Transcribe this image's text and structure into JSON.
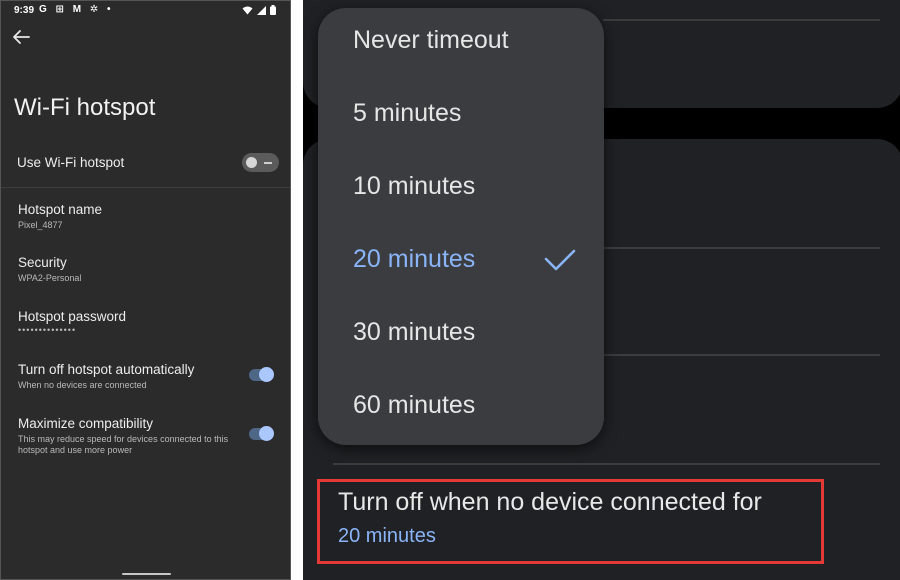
{
  "status_bar": {
    "time": "9:39",
    "icons": "G ⊞ M ✲ •"
  },
  "left": {
    "title": "Wi-Fi hotspot",
    "use_hotspot": {
      "label": "Use Wi-Fi hotspot",
      "enabled": false
    },
    "hotspot_name": {
      "label": "Hotspot name",
      "value": "Pixel_4877"
    },
    "security": {
      "label": "Security",
      "value": "WPA2-Personal"
    },
    "password": {
      "label": "Hotspot password",
      "value": "••••••••••••••"
    },
    "turn_off_auto": {
      "label": "Turn off hotspot automatically",
      "description": "When no devices are connected",
      "enabled": true
    },
    "maximize": {
      "label": "Maximize compatibility",
      "description": "This may reduce speed for devices connected to this hotspot and use more power",
      "enabled": true
    }
  },
  "right": {
    "menu": {
      "items": [
        {
          "label": "Never timeout",
          "selected": false
        },
        {
          "label": "5 minutes",
          "selected": false
        },
        {
          "label": "10 minutes",
          "selected": false
        },
        {
          "label": "20 minutes",
          "selected": true
        },
        {
          "label": "30 minutes",
          "selected": false
        },
        {
          "label": "60 minutes",
          "selected": false
        }
      ]
    },
    "setting": {
      "title": "Turn off when no device connected for",
      "value": "20 minutes"
    }
  },
  "colors": {
    "accent": "#8ab4f8",
    "highlight": "#e53935"
  }
}
